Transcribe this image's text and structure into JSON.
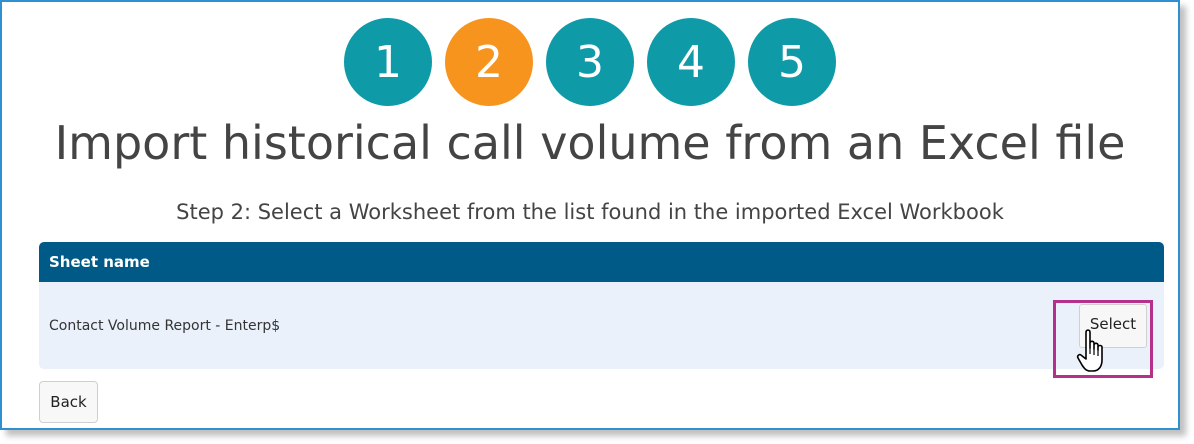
{
  "wizard": {
    "steps": [
      "1",
      "2",
      "3",
      "4",
      "5"
    ],
    "active_step": "2",
    "colors": {
      "step": "#0e9aa7",
      "active_step": "#f7941d"
    }
  },
  "page": {
    "title": "Import historical call volume from an Excel file",
    "subtitle": "Step 2: Select a Worksheet from the list found in the imported Excel Workbook"
  },
  "table": {
    "header": "Sheet name",
    "rows": [
      {
        "sheet_name": "Contact Volume Report - Enterp$",
        "action_label": "Select"
      }
    ],
    "colors": {
      "header": "#005a87",
      "row": "#eaf1fb"
    }
  },
  "footer": {
    "back_label": "Back"
  },
  "highlight_color": "#b5308a"
}
